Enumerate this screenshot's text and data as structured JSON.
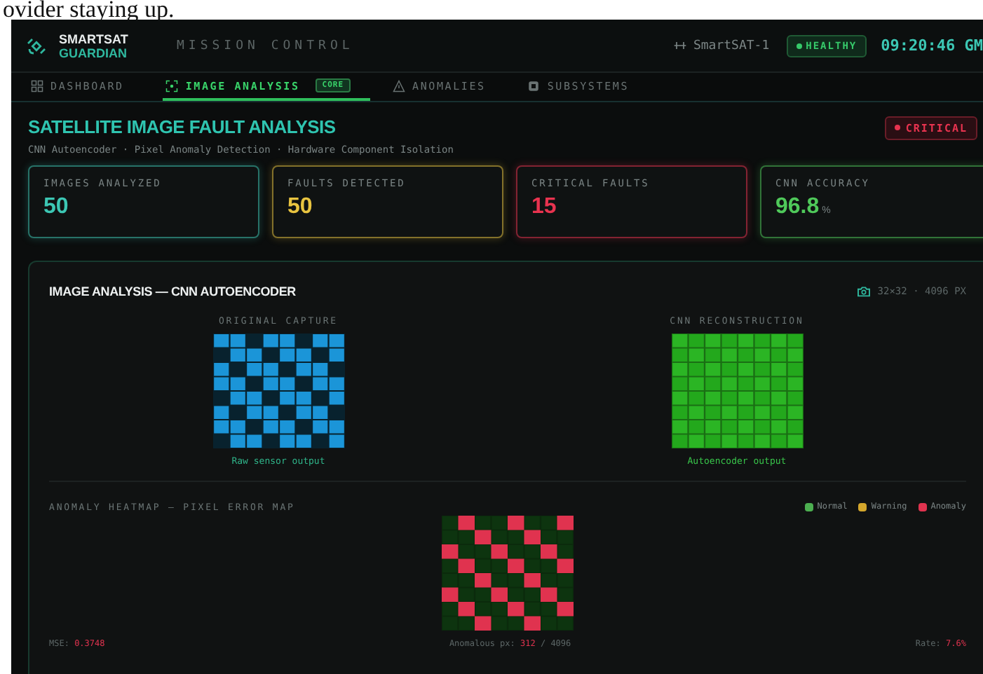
{
  "page_fragment": "ovider staying up.",
  "header": {
    "brand_top": "SMARTSAT",
    "brand_bottom": "GUARDIAN",
    "section": "MISSION CONTROL",
    "satellite": "SmartSAT-1",
    "health": "HEALTHY",
    "time": "09:20:46 GM"
  },
  "tabs": [
    {
      "label": "DASHBOARD",
      "kind": "grid",
      "selected": false
    },
    {
      "label": "IMAGE ANALYSIS",
      "kind": "scan",
      "selected": true,
      "badge": "CORE"
    },
    {
      "label": "ANOMALIES",
      "kind": "warning",
      "selected": false
    },
    {
      "label": "SUBSYSTEMS",
      "kind": "chip",
      "selected": false
    }
  ],
  "page": {
    "title": "SATELLITE IMAGE FAULT ANALYSIS",
    "subtitle": "CNN Autoencoder · Pixel Anomaly Detection · Hardware Component Isolation",
    "status": "CRITICAL"
  },
  "stats": [
    {
      "label": "IMAGES ANALYZED",
      "value": "50",
      "color": "#3cc7b4"
    },
    {
      "label": "FAULTS DETECTED",
      "value": "50",
      "color": "#e8c440"
    },
    {
      "label": "CRITICAL FAULTS",
      "value": "15",
      "color": "#e8334f"
    },
    {
      "label": "CNN ACCURACY",
      "value": "96.8",
      "unit": "%",
      "color": "#4fc95a"
    }
  ],
  "panel": {
    "title": "IMAGE ANALYSIS — CNN AUTOENCODER",
    "resolution": "32×32 · 4096 PX",
    "views": [
      {
        "kind": "original",
        "label": "ORIGINAL CAPTURE",
        "caption": "Raw sensor output"
      },
      {
        "kind": "reconstruction",
        "label": "CNN RECONSTRUCTION",
        "caption": "Autoencoder output"
      }
    ],
    "heatmap": {
      "title": "ANOMALY HEATMAP — PIXEL ERROR MAP",
      "legend": [
        {
          "label": "Normal",
          "color": "#4caf50"
        },
        {
          "label": "Warning",
          "color": "#d4a72c"
        },
        {
          "label": "Anomaly",
          "color": "#e0334f"
        }
      ]
    },
    "footer": {
      "mse_label": "MSE:",
      "mse": "0.3748",
      "anomalous_label": "Anomalous px:",
      "anomalous": "312",
      "anomalous_total": "/ 4096",
      "rate_label": "Rate:",
      "rate": "7.6%"
    }
  }
}
